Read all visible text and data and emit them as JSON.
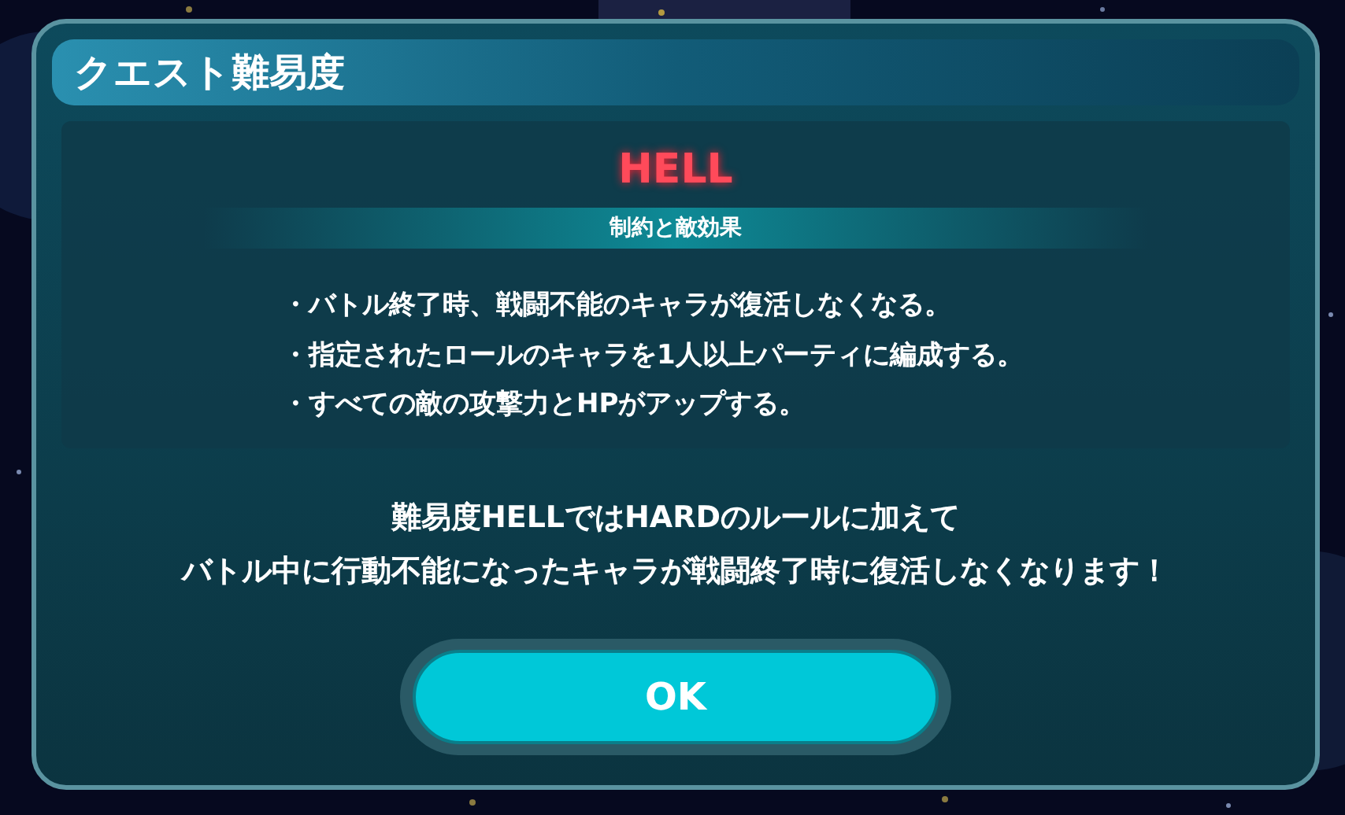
{
  "dialog": {
    "title": "クエスト難易度",
    "difficulty": "HELL",
    "section_label": "制約と敵効果",
    "rules": [
      "・バトル終了時、戦闘不能のキャラが復活しなくなる。",
      "・指定されたロールのキャラを1人以上パーティに編成する。",
      "・すべての敵の攻撃力とHPがアップする。"
    ],
    "note_lines": [
      "難易度HELLではHARDのルールに加えて",
      "バトル中に行動不能になったキャラが戦闘終了時に復活しなくなります！"
    ],
    "button": "OK"
  }
}
